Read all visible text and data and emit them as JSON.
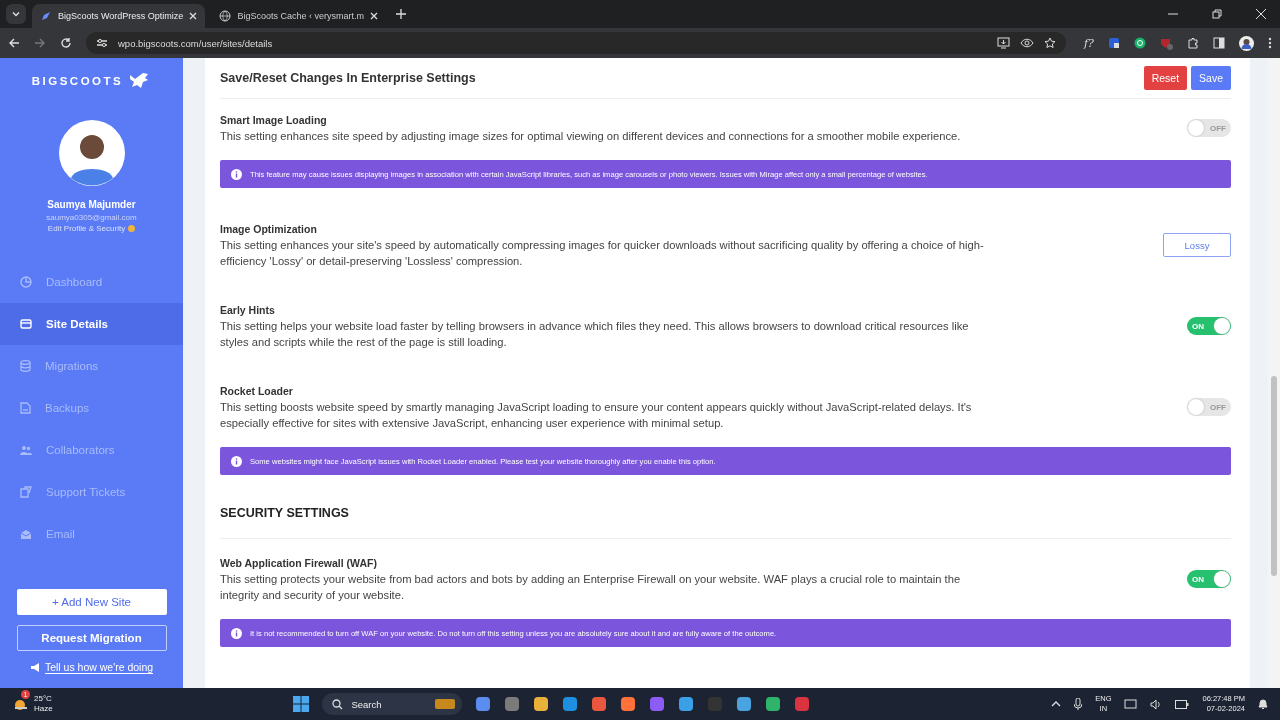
{
  "browser": {
    "tabs": [
      {
        "title": "BigScoots WordPress Optimize",
        "selected": true
      },
      {
        "title": "BigScoots Cache ‹ verysmart.m",
        "selected": false
      }
    ],
    "url": "wpo.bigscoots.com/user/sites/details",
    "extension_glyph": "f?"
  },
  "sidebar": {
    "brand": "BIGSCOOTS",
    "user_name": "Saumya Majumder",
    "email": "saumya0305@gmail.com",
    "profile_link": "Edit Profile & Security",
    "nav": [
      {
        "label": "Dashboard",
        "selected": false
      },
      {
        "label": "Site Details",
        "selected": true
      },
      {
        "label": "Migrations",
        "selected": false
      },
      {
        "label": "Backups",
        "selected": false
      },
      {
        "label": "Collaborators",
        "selected": false
      },
      {
        "label": "Support Tickets",
        "selected": false
      },
      {
        "label": "Email",
        "selected": false
      }
    ],
    "add_site": "+ Add New Site",
    "request_migration": "Request Migration",
    "feedback": "Tell us how we're doing"
  },
  "header": {
    "title": "Save/Reset Changes In Enterprise Settings",
    "reset": "Reset",
    "save": "Save"
  },
  "items": [
    {
      "kind": "setting",
      "title": "Smart Image Loading",
      "description": "This setting enhances site speed by adjusting image sizes for optimal viewing on different devices and connections for a smoother mobile experience.",
      "control": {
        "kind": "toggle",
        "on": false,
        "label": "OFF"
      },
      "notice": "This feature may cause issues displaying images in association with certain JavaScript libraries, such as image carousels or photo viewers. Issues with Mirage affect only a small percentage of websites."
    },
    {
      "kind": "setting",
      "title": "Image Optimization",
      "description": "This setting enhances your site's speed by automatically compressing images for quicker downloads without sacrificing quality by offering a choice of high-efficiency 'Lossy' or detail-preserving 'Lossless' compression.",
      "control": {
        "kind": "select",
        "value": "Lossy"
      }
    },
    {
      "kind": "setting",
      "title": "Early Hints",
      "description": "This setting helps your website load faster by telling browsers in advance which files they need. This allows browsers to download critical resources like styles and scripts while the rest of the page is still loading.",
      "control": {
        "kind": "toggle",
        "on": true,
        "label": "ON"
      }
    },
    {
      "kind": "setting",
      "title": "Rocket Loader",
      "description": "This setting boosts website speed by smartly managing JavaScript loading to ensure your content appears quickly without JavaScript-related delays. It's especially effective for sites with extensive JavaScript, enhancing user experience with minimal setup.",
      "control": {
        "kind": "toggle",
        "on": false,
        "label": "OFF"
      },
      "notice": "Some websites might face JavaScript issues with Rocket Loader enabled. Please test your website thoroughly after you enable this option."
    },
    {
      "kind": "heading",
      "title": "SECURITY SETTINGS"
    },
    {
      "kind": "setting",
      "title": "Web Application Firewall (WAF)",
      "description": "This setting protects your website from bad actors and bots by adding an Enterprise Firewall on your website. WAF plays a crucial role to maintain the integrity and security of your website.",
      "control": {
        "kind": "toggle",
        "on": true,
        "label": "ON"
      },
      "notice": "It is not recommended to turn off WAF on your website. Do not turn off this setting unless you are absolutely sure about it and are fully aware of the outcome."
    }
  ],
  "taskbar": {
    "notification_count": "1",
    "temperature": "25°C",
    "weather": "Haze",
    "search": "Search",
    "language": "ENG",
    "region": "IN",
    "time": "06:27:48 PM",
    "date": "07-02-2024"
  }
}
